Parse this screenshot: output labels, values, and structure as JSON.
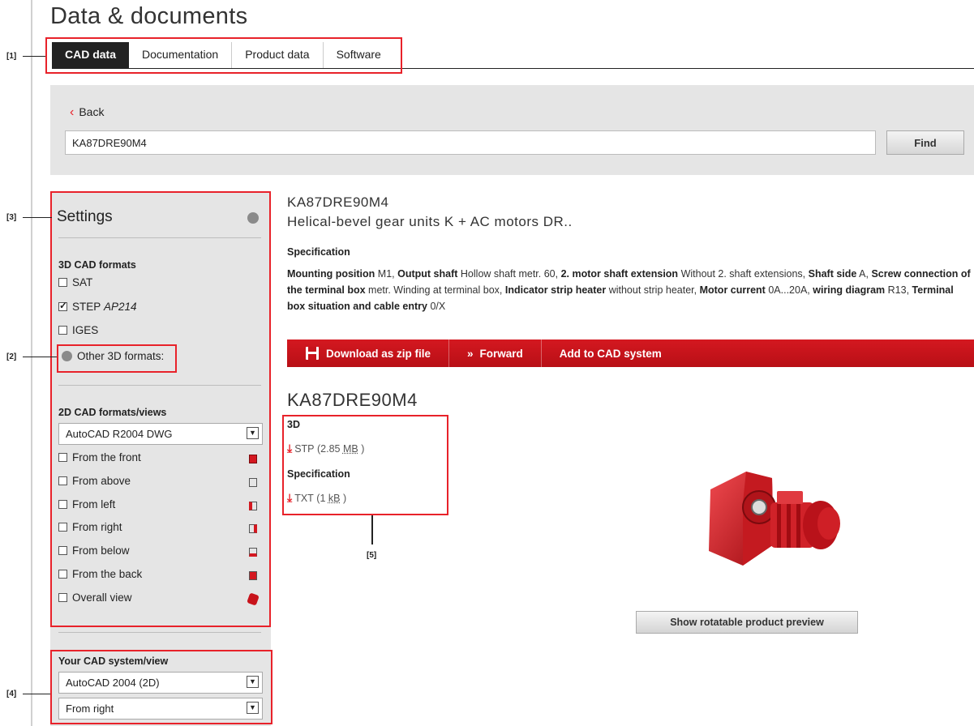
{
  "page": {
    "title": "Data & documents"
  },
  "tabs": [
    {
      "label": "CAD data",
      "active": true
    },
    {
      "label": "Documentation",
      "active": false
    },
    {
      "label": "Product data",
      "active": false
    },
    {
      "label": "Software",
      "active": false
    }
  ],
  "search": {
    "back_label": "Back",
    "value": "KA87DRE90M4",
    "find_label": "Find"
  },
  "settings": {
    "title": "Settings",
    "cad3d": {
      "title": "3D CAD formats",
      "options": [
        {
          "label": "SAT",
          "checked": false
        },
        {
          "label": "STEP",
          "suffix": "AP214",
          "checked": true
        },
        {
          "label": "IGES",
          "checked": false
        }
      ],
      "other_label": "Other 3D formats:"
    },
    "cad2d": {
      "title": "2D CAD formats/views",
      "format_selected": "AutoCAD R2004 DWG",
      "views": [
        {
          "label": "From the front",
          "checked": false
        },
        {
          "label": "From above",
          "checked": false
        },
        {
          "label": "From left",
          "checked": false
        },
        {
          "label": "From right",
          "checked": false
        },
        {
          "label": "From below",
          "checked": false
        },
        {
          "label": "From the back",
          "checked": false
        },
        {
          "label": "Overall view",
          "checked": false
        }
      ]
    },
    "system": {
      "title": "Your CAD system/view",
      "system_selected": "AutoCAD 2004 (2D)",
      "view_selected": "From right"
    }
  },
  "product": {
    "code": "KA87DRE90M4",
    "name": "Helical-bevel gear units K + AC motors DR..",
    "spec_title": "Specification",
    "spec": [
      {
        "k": "Mounting position",
        "v": "M1,"
      },
      {
        "k": "Output shaft",
        "v": "Hollow shaft metr. 60,"
      },
      {
        "k": "2. motor shaft extension",
        "v": "Without 2. shaft extensions,"
      },
      {
        "k": "Shaft side",
        "v": "A,"
      },
      {
        "k": "Screw connection of the terminal box",
        "v": "metr. Winding at terminal box,"
      },
      {
        "k": "Indicator strip heater",
        "v": "without strip heater,"
      },
      {
        "k": "Motor current",
        "v": "0A...20A,"
      },
      {
        "k": "wiring diagram",
        "v": "R13,"
      },
      {
        "k": "Terminal box situation and cable entry",
        "v": "0/X"
      }
    ]
  },
  "actions": {
    "download_zip": "Download as zip file",
    "forward": "Forward",
    "add_to_cad": "Add to CAD system"
  },
  "files": {
    "code": "KA87DRE90M4",
    "groups": [
      {
        "title": "3D",
        "format": "STP",
        "size_num": "2.85",
        "size_unit": "MB"
      },
      {
        "title": "Specification",
        "format": "TXT",
        "size_num": "1",
        "size_unit": "kB"
      }
    ]
  },
  "preview": {
    "button_label": "Show rotatable product preview"
  },
  "annotations": [
    "[1]",
    "[2]",
    "[3]",
    "[4]",
    "[5]"
  ],
  "colors": {
    "accent": "#e8222a",
    "bar": "#c8131b",
    "panel": "#e5e5e5",
    "tab_active": "#222222"
  }
}
